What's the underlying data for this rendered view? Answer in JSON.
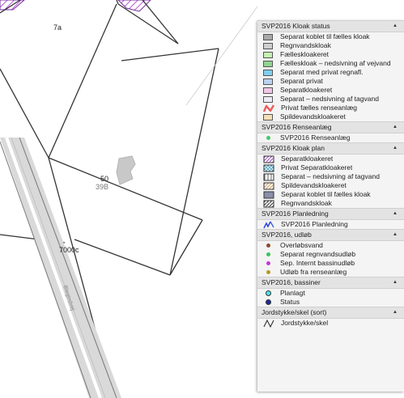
{
  "map": {
    "labels": {
      "parcel_7a": "7a",
      "parcel_50": "50",
      "parcel_39b": "39B",
      "parcel_7000c": "7000c",
      "road": "Blegindvej"
    }
  },
  "legend": {
    "kloak_status": {
      "title": "SVP2016 Kloak status",
      "items": [
        {
          "label": "Separat koblet til fælles kloak",
          "color": "#a9a9a9"
        },
        {
          "label": "Regnvandskloak",
          "color": "#cfcfcf"
        },
        {
          "label": "Fælleskloakeret",
          "color": "#c6f2b4"
        },
        {
          "label": "Fælleskloak – nedsivning af vejvand",
          "color": "#90d490"
        },
        {
          "label": "Separat med privat regnafl.",
          "color": "#7fd0ee"
        },
        {
          "label": "Separat privat",
          "color": "#b9d2ee"
        },
        {
          "label": "Separatkloakeret",
          "color": "#f2c6e6"
        },
        {
          "label": "Separat – nedsivning af tagvand",
          "color": "#ececf7"
        },
        {
          "label": "Privat fælles renseanlæg",
          "color": "#ef5a5a",
          "icon": "zigzag-icon"
        },
        {
          "label": "Spildevandskloakeret",
          "color": "#f5dfb6"
        }
      ]
    },
    "renseanlaeg": {
      "title": "SVP2016 Renseanlæg",
      "items": [
        {
          "label": "SVP2016 Renseanlæg",
          "color": "#45c96a"
        }
      ]
    },
    "kloak_plan": {
      "title": "SVP2016 Kloak plan",
      "items": [
        {
          "label": "Separatkloakeret",
          "color": "#9a4fc4",
          "pattern": "diagonal-hatch"
        },
        {
          "label": "Privat Separatkloakeret",
          "color": "#4aa3c0",
          "pattern": "cross-hatch"
        },
        {
          "label": "Separat – nedsivning af tagvand",
          "color": "#555555",
          "pattern": "vertical-lines"
        },
        {
          "label": "Spildevandskloakeret",
          "color": "#c89a5a",
          "pattern": "diagonal-hatch"
        },
        {
          "label": "Separat koblet til fælles kloak",
          "color": "#8a8fa8",
          "pattern": "solid"
        },
        {
          "label": "Regnvandskloak",
          "color": "#333333",
          "pattern": "diagonal-hatch"
        }
      ]
    },
    "planledning": {
      "title": "SVP2016 Planledning",
      "items": [
        {
          "label": "SVP2016 Planledning",
          "color": "#2a3fd6",
          "icon": "planledning-line-icon"
        }
      ]
    },
    "udloeb": {
      "title": "SVP2016, udløb",
      "items": [
        {
          "label": "Overløbsvand",
          "color": "#8b4a2b"
        },
        {
          "label": "Separat regnvandsudløb",
          "color": "#3fc25a"
        },
        {
          "label": "Sep. Internt bassinudløb",
          "color": "#c43ad0"
        },
        {
          "label": "Udløb fra renseanlæg",
          "color": "#b39a2a"
        }
      ]
    },
    "bassiner": {
      "title": "SVP2016, bassiner",
      "items": [
        {
          "label": "Planlagt",
          "color": "#4fe3ee"
        },
        {
          "label": "Status",
          "color": "#1a2a9a"
        }
      ]
    },
    "jordstykke": {
      "title": "Jordstykke/skel (sort)",
      "items": [
        {
          "label": "Jordstykke/skel",
          "color": "#222222",
          "icon": "jordstykke-line-icon"
        }
      ]
    }
  }
}
